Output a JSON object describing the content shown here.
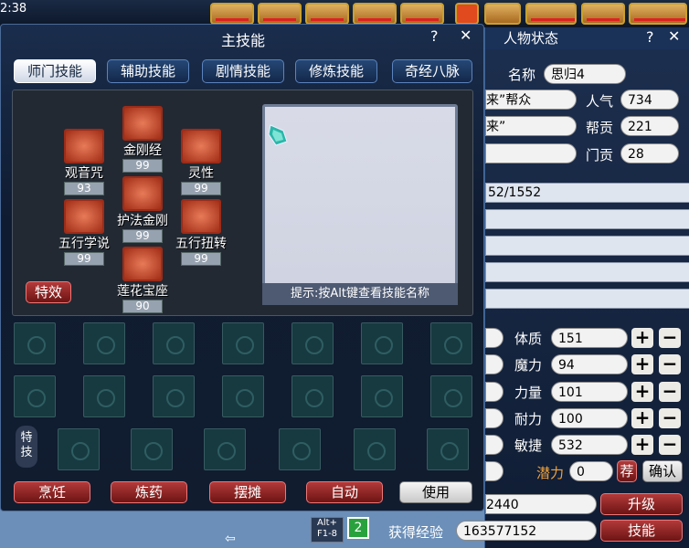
{
  "hud": {
    "time": "2:38"
  },
  "main_window": {
    "title": "主技能",
    "help": "?",
    "close": "✕",
    "tabs": [
      "师门技能",
      "辅助技能",
      "剧情技能",
      "修炼技能",
      "奇经八脉"
    ],
    "active_tab": 0,
    "skills": [
      {
        "name": "金刚经",
        "level": "99",
        "icon": "temple-icon"
      },
      {
        "name": "观音咒",
        "level": "93",
        "icon": "buddha-icon"
      },
      {
        "name": "灵性",
        "level": "99",
        "icon": "lotus-icon"
      },
      {
        "name": "护法金刚",
        "level": "99",
        "icon": "trident-icon"
      },
      {
        "name": "五行学说",
        "level": "99",
        "icon": "bagua-icon"
      },
      {
        "name": "五行扭转",
        "level": "99",
        "icon": "beads-icon"
      },
      {
        "name": "莲花宝座",
        "level": "90",
        "icon": "throne-icon"
      }
    ],
    "special_effect_label": "特效",
    "hint": "提示:按Alt键查看技能名称",
    "special_label": "特技",
    "buttons": [
      "烹饪",
      "炼药",
      "摆摊",
      "自动",
      "使用"
    ]
  },
  "status_panel": {
    "title": "人物状态",
    "help": "?",
    "close": "✕",
    "name_label": "名称",
    "name_value": "思归4",
    "gang_fragment": "来”帮众",
    "popularity_label": "人气",
    "popularity_value": "734",
    "title_fragment": "来”",
    "contribution_label": "帮贡",
    "contribution_value": "221",
    "school_contrib_label": "门贡",
    "school_contrib_value": "28",
    "hp_fragment": "52/1552",
    "attributes": [
      {
        "label": "体质",
        "value": "151"
      },
      {
        "label": "魔力",
        "value": "94"
      },
      {
        "label": "力量",
        "value": "101"
      },
      {
        "label": "耐力",
        "value": "100"
      },
      {
        "label": "敏捷",
        "value": "532"
      }
    ],
    "potential_label": "潜力",
    "potential_value": "0",
    "recommend_label": "荐",
    "confirm_label": "确认",
    "exp_needed_fragment": "2440",
    "upgrade_label": "升级",
    "exp_label": "获得经验",
    "exp_value": "163577152",
    "skills_label": "技能"
  },
  "hotkeys": {
    "alt": "Alt+ F1-8",
    "page": "2"
  }
}
